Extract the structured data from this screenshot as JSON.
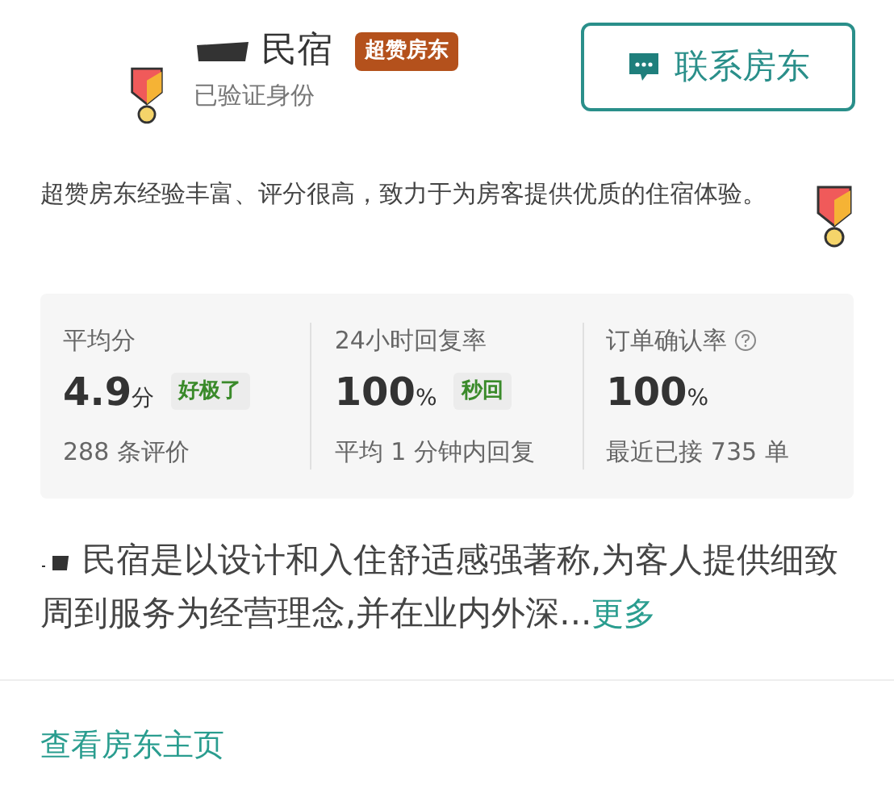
{
  "host": {
    "name": "民宿",
    "badge": "超赞房东",
    "verified": "已验证身份"
  },
  "contact_button": {
    "label": "联系房东"
  },
  "superhost_note": "超赞房东经验丰富、评分很高，致力于为房客提供优质的住宿体验。",
  "stats": [
    {
      "label": "平均分",
      "value": "4.9",
      "unit": "分",
      "tag": "好极了",
      "detail": "288 条评价",
      "help": false
    },
    {
      "label": "24小时回复率",
      "value": "100",
      "unit": "%",
      "tag": "秒回",
      "detail": "平均 1 分钟内回复",
      "help": false
    },
    {
      "label": "订单确认率",
      "value": "100",
      "unit": "%",
      "detail": "最近已接 735 单",
      "help": true
    }
  ],
  "description": {
    "text": "民宿是以设计和入住舒适感强著称,为客人提供细致周到服务为经营理念,并在业内外深...",
    "more": "更多"
  },
  "profile_link": "查看房东主页"
}
